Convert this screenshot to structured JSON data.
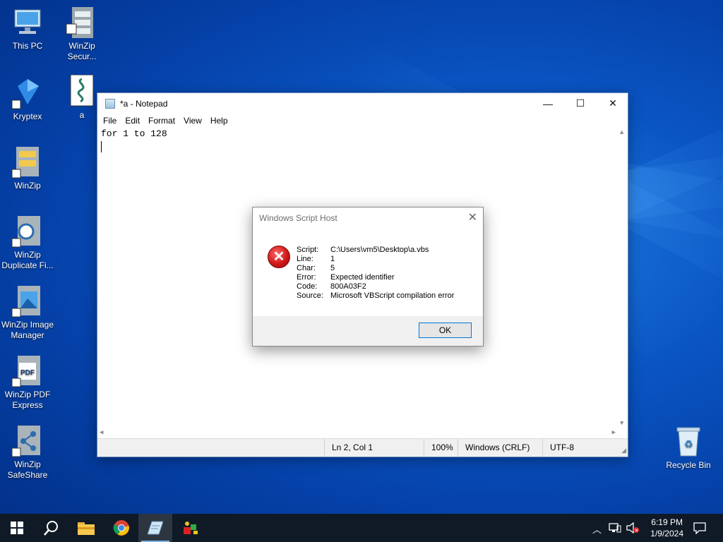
{
  "desktop": {
    "icons": [
      {
        "label": "This PC",
        "icon": "computer-icon"
      },
      {
        "label": "WinZip Secur...",
        "icon": "winzip-secure-icon"
      },
      {
        "label": "Kryptex",
        "icon": "kryptex-icon"
      },
      {
        "label": "a",
        "icon": "vbscript-file-icon"
      },
      {
        "label": "WinZip",
        "icon": "winzip-icon"
      },
      {
        "label": "WinZip Duplicate Fi...",
        "icon": "winzip-duplicate-icon"
      },
      {
        "label": "WinZip Image Manager",
        "icon": "winzip-image-icon"
      },
      {
        "label": "WinZip PDF Express",
        "icon": "winzip-pdf-icon"
      },
      {
        "label": "WinZip SafeShare",
        "icon": "winzip-safeshare-icon"
      },
      {
        "label": "Recycle Bin",
        "icon": "recycle-bin-icon"
      }
    ]
  },
  "notepad": {
    "title": "*a - Notepad",
    "controls": {
      "minimize": "—",
      "maximize": "☐",
      "close": "✕"
    },
    "menu": [
      "File",
      "Edit",
      "Format",
      "View",
      "Help"
    ],
    "content": {
      "line1": "for 1 to 128",
      "line2": ""
    },
    "status": {
      "position": "Ln 2, Col 1",
      "zoom": "100%",
      "line_ending": "Windows (CRLF)",
      "encoding": "UTF-8"
    }
  },
  "dialog": {
    "title": "Windows Script Host",
    "close": "✕",
    "fields": [
      {
        "key": "Script:",
        "value": "C:\\Users\\vm5\\Desktop\\a.vbs"
      },
      {
        "key": "Line:",
        "value": "1"
      },
      {
        "key": "Char:",
        "value": "5"
      },
      {
        "key": "Error:",
        "value": "Expected identifier"
      },
      {
        "key": "Code:",
        "value": "800A03F2"
      },
      {
        "key": "Source:",
        "value": "Microsoft VBScript compilation error"
      }
    ],
    "ok_label": "OK"
  },
  "taskbar": {
    "apps": [
      "start-icon",
      "search-icon",
      "file-explorer-icon",
      "chrome-icon",
      "notepad-icon",
      "app-icon"
    ],
    "time": "6:19 PM",
    "date": "1/9/2024"
  }
}
